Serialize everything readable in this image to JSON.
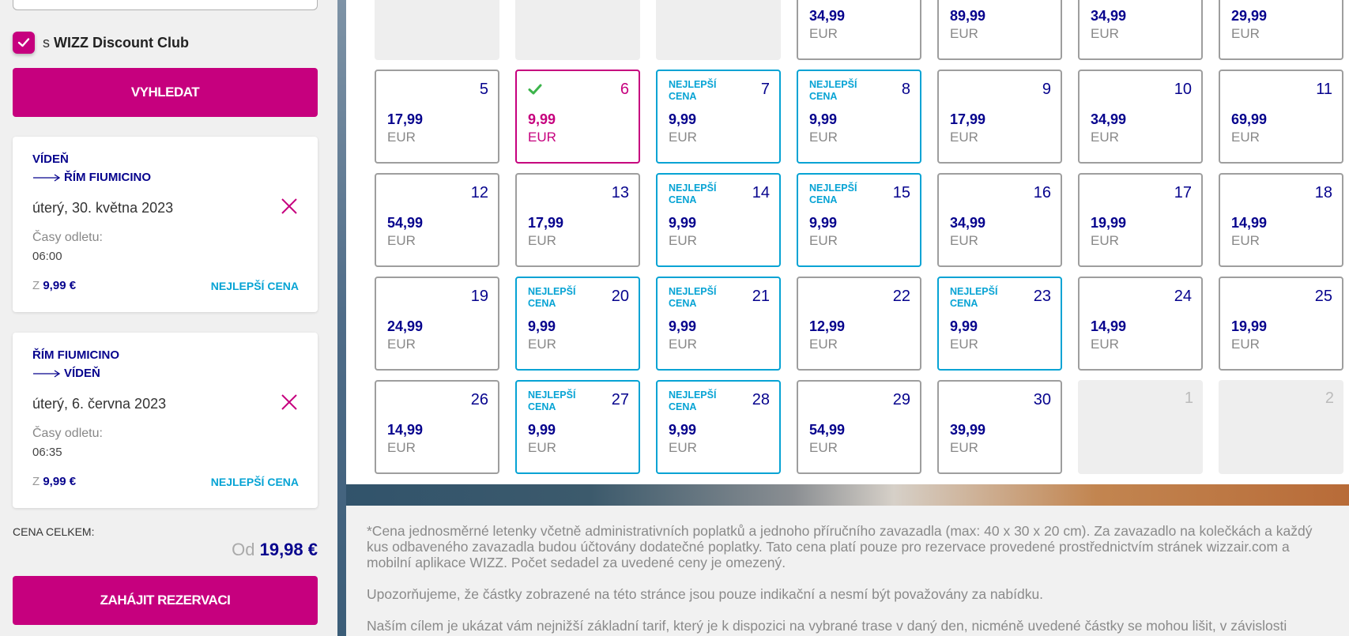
{
  "sidebar": {
    "discount_prefix": "s",
    "discount_label": "WIZZ Discount Club",
    "search_button": "VYHLEDAT",
    "flights": [
      {
        "from": "VÍDEŇ",
        "to": "ŘÍM FIUMICINO",
        "date": "úterý, 30. května 2023",
        "times_label": "Časy odletu:",
        "time": "06:00",
        "from_prefix": "Z",
        "price": "9,99 €",
        "badge": "NEJLEPŠÍ CENA"
      },
      {
        "from": "ŘÍM FIUMICINO",
        "to": "VÍDEŇ",
        "date": "úterý, 6. června 2023",
        "times_label": "Časy odletu:",
        "time": "06:35",
        "from_prefix": "Z",
        "price": "9,99 €",
        "badge": "NEJLEPŠÍ CENA"
      }
    ],
    "total_label": "CENA CELKEM:",
    "total_prefix": "Od",
    "total_price": "19,98 €",
    "reserve_button": "ZAHÁJIT REZERVACI"
  },
  "calendar": {
    "currency": "EUR",
    "best_label": "NEJLEPŠÍ CENA",
    "rows": [
      [
        {
          "day": "",
          "price": "",
          "state": "empty"
        },
        {
          "day": "",
          "price": "",
          "state": "empty"
        },
        {
          "day": "",
          "price": "",
          "state": "empty"
        },
        {
          "day": "",
          "price": "34,99",
          "state": "normal"
        },
        {
          "day": "",
          "price": "89,99",
          "state": "normal"
        },
        {
          "day": "",
          "price": "34,99",
          "state": "normal"
        },
        {
          "day": "",
          "price": "29,99",
          "state": "normal"
        }
      ],
      [
        {
          "day": "5",
          "price": "17,99",
          "state": "normal"
        },
        {
          "day": "6",
          "price": "9,99",
          "state": "selected"
        },
        {
          "day": "7",
          "price": "9,99",
          "state": "best"
        },
        {
          "day": "8",
          "price": "9,99",
          "state": "best"
        },
        {
          "day": "9",
          "price": "17,99",
          "state": "normal"
        },
        {
          "day": "10",
          "price": "34,99",
          "state": "normal"
        },
        {
          "day": "11",
          "price": "69,99",
          "state": "normal"
        }
      ],
      [
        {
          "day": "12",
          "price": "54,99",
          "state": "normal"
        },
        {
          "day": "13",
          "price": "17,99",
          "state": "normal"
        },
        {
          "day": "14",
          "price": "9,99",
          "state": "best"
        },
        {
          "day": "15",
          "price": "9,99",
          "state": "best"
        },
        {
          "day": "16",
          "price": "34,99",
          "state": "normal"
        },
        {
          "day": "17",
          "price": "19,99",
          "state": "normal"
        },
        {
          "day": "18",
          "price": "14,99",
          "state": "normal"
        }
      ],
      [
        {
          "day": "19",
          "price": "24,99",
          "state": "normal"
        },
        {
          "day": "20",
          "price": "9,99",
          "state": "best"
        },
        {
          "day": "21",
          "price": "9,99",
          "state": "best"
        },
        {
          "day": "22",
          "price": "12,99",
          "state": "normal"
        },
        {
          "day": "23",
          "price": "9,99",
          "state": "best"
        },
        {
          "day": "24",
          "price": "14,99",
          "state": "normal"
        },
        {
          "day": "25",
          "price": "19,99",
          "state": "normal"
        }
      ],
      [
        {
          "day": "26",
          "price": "14,99",
          "state": "normal"
        },
        {
          "day": "27",
          "price": "9,99",
          "state": "best"
        },
        {
          "day": "28",
          "price": "9,99",
          "state": "best"
        },
        {
          "day": "29",
          "price": "54,99",
          "state": "normal"
        },
        {
          "day": "30",
          "price": "39,99",
          "state": "normal"
        },
        {
          "day": "1",
          "price": "",
          "state": "empty"
        },
        {
          "day": "2",
          "price": "",
          "state": "empty"
        }
      ]
    ]
  },
  "disclaimer": {
    "p1": "*Cena jednosměrné letenky včetně administrativních poplatků a jednoho příručního zavazadla (max: 40 x 30 x 20 cm). Za zavazadlo na kolečkách a každý kus odbaveného zavazadla budou účtovány dodatečné poplatky. Tato cena platí pouze pro rezervace provedené prostřednictvím stránek wizzair.com a mobilní aplikace WIZZ. Počet sedadel za uvedené ceny je omezený.",
    "p2": "Upozorňujeme, že částky zobrazené na této stránce jsou pouze indikační a nesmí být považovány za nabídku.",
    "p3": "Naším cílem je ukázat vám nejnižší základní tarif, který je k dispozici na vybrané trase v daný den, nicméně uvedené částky se mohou lišit, v závislosti"
  },
  "colors": {
    "brand_magenta": "#c6007e",
    "navy": "#06038d",
    "best_blue": "#06a3d4"
  }
}
